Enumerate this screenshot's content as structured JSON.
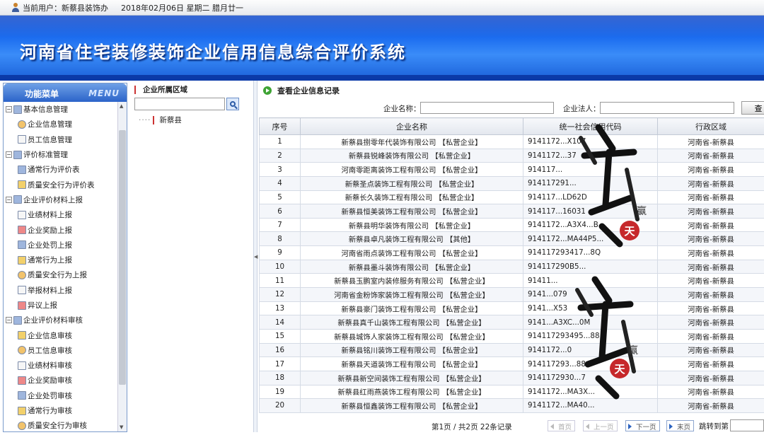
{
  "topbar": {
    "user_label": "当前用户：新蔡县装饰办",
    "date_text": "2018年02月06日 星期二 腊月廿一"
  },
  "banner": {
    "title": "河南省住宅装修装饰企业信用信息综合评价系统"
  },
  "menu": {
    "title": "功能菜单",
    "title_en": "MENU",
    "items": [
      {
        "label": "基本信息管理",
        "level": 0
      },
      {
        "label": "企业信息管理",
        "level": 1
      },
      {
        "label": "员工信息管理",
        "level": 1
      },
      {
        "label": "评价标准管理",
        "level": 0
      },
      {
        "label": "通常行为评价表",
        "level": 1
      },
      {
        "label": "质量安全行为评价表",
        "level": 1
      },
      {
        "label": "企业评价材料上报",
        "level": 0
      },
      {
        "label": "业绩材料上报",
        "level": 1
      },
      {
        "label": "企业奖励上报",
        "level": 1
      },
      {
        "label": "企业处罚上报",
        "level": 1
      },
      {
        "label": "通常行为上报",
        "level": 1
      },
      {
        "label": "质量安全行为上报",
        "level": 1
      },
      {
        "label": "举报材料上报",
        "level": 1
      },
      {
        "label": "异议上报",
        "level": 1
      },
      {
        "label": "企业评价材料审核",
        "level": 0
      },
      {
        "label": "企业信息审核",
        "level": 1
      },
      {
        "label": "员工信息审核",
        "level": 1
      },
      {
        "label": "业绩材料审核",
        "level": 1
      },
      {
        "label": "企业奖励审核",
        "level": 1
      },
      {
        "label": "企业处罚审核",
        "level": 1
      },
      {
        "label": "通常行为审核",
        "level": 1
      },
      {
        "label": "质量安全行为审核",
        "level": 1
      }
    ]
  },
  "region_panel": {
    "title": "企业所属区域",
    "node": "新蔡县"
  },
  "main": {
    "title": "查看企业信息记录",
    "filter": {
      "company_label": "企业名称：",
      "legal_label": "企业法人：",
      "search_button": "查"
    },
    "columns": [
      "序号",
      "企业名称",
      "统一社会信用代码",
      "行政区域"
    ],
    "rows": [
      [
        "1",
        "新蔡县捌零年代装饰有限公司 【私营企业】",
        "9141172...X107",
        "河南省-新蔡县"
      ],
      [
        "2",
        "新蔡县锐峰装饰有限公司 【私营企业】",
        "9141172...37",
        "河南省-新蔡县"
      ],
      [
        "3",
        "河南零距离装饰工程有限公司 【私营企业】",
        "914117...",
        "河南省-新蔡县"
      ],
      [
        "4",
        "新蔡圣点装饰工程有限公司 【私营企业】",
        "914117291...",
        "河南省-新蔡县"
      ],
      [
        "5",
        "新蔡长久装饰工程有限公司 【私营企业】",
        "914117...LD62D",
        "河南省-新蔡县"
      ],
      [
        "6",
        "新蔡县恒美装饰工程有限公司 【私营企业】",
        "914117...16031",
        "河南省-新蔡县"
      ],
      [
        "7",
        "新蔡县明华装饰有限公司 【私营企业】",
        "9141172...A3X4...B",
        "河南省-新蔡县"
      ],
      [
        "8",
        "新蔡县卓凡装饰工程有限公司 【其他】",
        "9141172...MA44P5...",
        "河南省-新蔡县"
      ],
      [
        "9",
        "河南省雨点装饰工程有限公司 【私营企业】",
        "914117293417...8Q",
        "河南省-新蔡县"
      ],
      [
        "10",
        "新蔡县墨斗装饰有限公司 【私营企业】",
        "914117290B5...",
        "河南省-新蔡县"
      ],
      [
        "11",
        "新蔡县玉鹏室内装修服务有限公司 【私营企业】",
        "91411...",
        "河南省-新蔡县"
      ],
      [
        "12",
        "河南省金粉饰家装饰工程有限公司 【私营企业】",
        "9141...079",
        "河南省-新蔡县"
      ],
      [
        "13",
        "新蔡县豪门装饰工程有限公司 【私营企业】",
        "9141...X53",
        "河南省-新蔡县"
      ],
      [
        "14",
        "新蔡县真千山装饰工程有限公司 【私营企业】",
        "9141...A3XC...0M",
        "河南省-新蔡县"
      ],
      [
        "15",
        "新蔡县城饰人家装饰工程有限公司 【私营企业】",
        "914117293495...88",
        "河南省-新蔡县"
      ],
      [
        "16",
        "新蔡县铭川装饰工程有限公司 【私营企业】",
        "9141172...0",
        "河南省-新蔡县"
      ],
      [
        "17",
        "新蔡县天道装饰工程有限公司 【私营企业】",
        "914117293...88",
        "河南省-新蔡县"
      ],
      [
        "18",
        "新蔡县新空间装饰工程有限公司 【私营企业】",
        "9141172930...7",
        "河南省-新蔡县"
      ],
      [
        "19",
        "新蔡县红雨燕装饰工程有限公司 【私营企业】",
        "9141172...MA3X...",
        "河南省-新蔡县"
      ],
      [
        "20",
        "新蔡县恒鑫装饰工程有限公司 【私营企业】",
        "9141172...MA40...",
        "河南省-新蔡县"
      ]
    ],
    "pager": {
      "info": "第1页 / 共2页 22条记录",
      "first": "首页",
      "prev": "上一页",
      "next": "下一页",
      "last": "末页",
      "jump_label": "跳转到第"
    }
  },
  "watermark": {
    "seal_char": "天",
    "side_char": "赢",
    "brush_text": "诚信"
  }
}
